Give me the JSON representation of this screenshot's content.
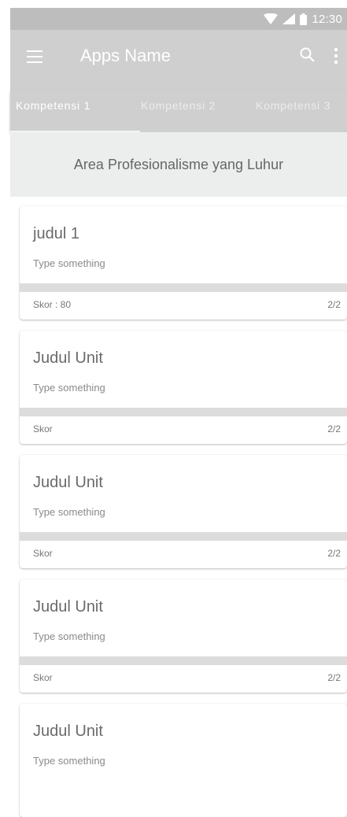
{
  "status_bar": {
    "time": "12:30"
  },
  "app_bar": {
    "title": "Apps Name"
  },
  "tabs": [
    {
      "label": "Kompetensi 1",
      "active": true
    },
    {
      "label": "Kompetensi 2",
      "active": false
    },
    {
      "label": "Kompetensi 3",
      "active": false
    }
  ],
  "area_title": "Area Profesionalisme yang Luhur",
  "cards": [
    {
      "title": "judul 1",
      "subtitle": "Type something",
      "score": "Skor : 80",
      "count": "2/2"
    },
    {
      "title": "Judul Unit",
      "subtitle": "Type something",
      "score": "Skor",
      "count": "2/2"
    },
    {
      "title": "Judul Unit",
      "subtitle": "Type something",
      "score": "Skor",
      "count": "2/2"
    },
    {
      "title": "Judul Unit",
      "subtitle": "Type something",
      "score": "Skor",
      "count": "2/2"
    },
    {
      "title": "Judul Unit",
      "subtitle": "Type something",
      "score": "",
      "count": ""
    }
  ],
  "icons": [
    "wifi-icon",
    "signal-icon",
    "battery-icon",
    "menu-icon",
    "search-icon",
    "more-vert-icon"
  ],
  "colors": {
    "app_bar": "#cfcfcf",
    "status_bar": "#bdbdbd",
    "header_bg": "#eceeee"
  }
}
